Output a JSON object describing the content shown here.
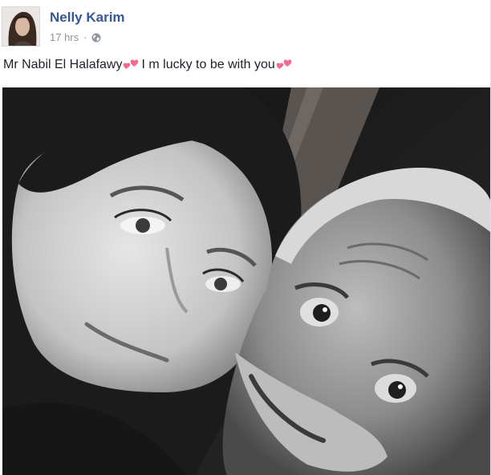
{
  "post": {
    "author": "Nelly Karim",
    "timestamp": "17 hrs",
    "separator": "·",
    "audience_icon": "globe-icon",
    "caption_part1": "Mr Nabil El Halafawy",
    "caption_part2": "I m lucky to be with you",
    "caption_emoji": "two-hearts-icon",
    "photo_style": "black-and-white selfie",
    "colors": {
      "author_link": "#365899",
      "meta_text": "#90949c",
      "heart": "#f36c8f"
    }
  }
}
